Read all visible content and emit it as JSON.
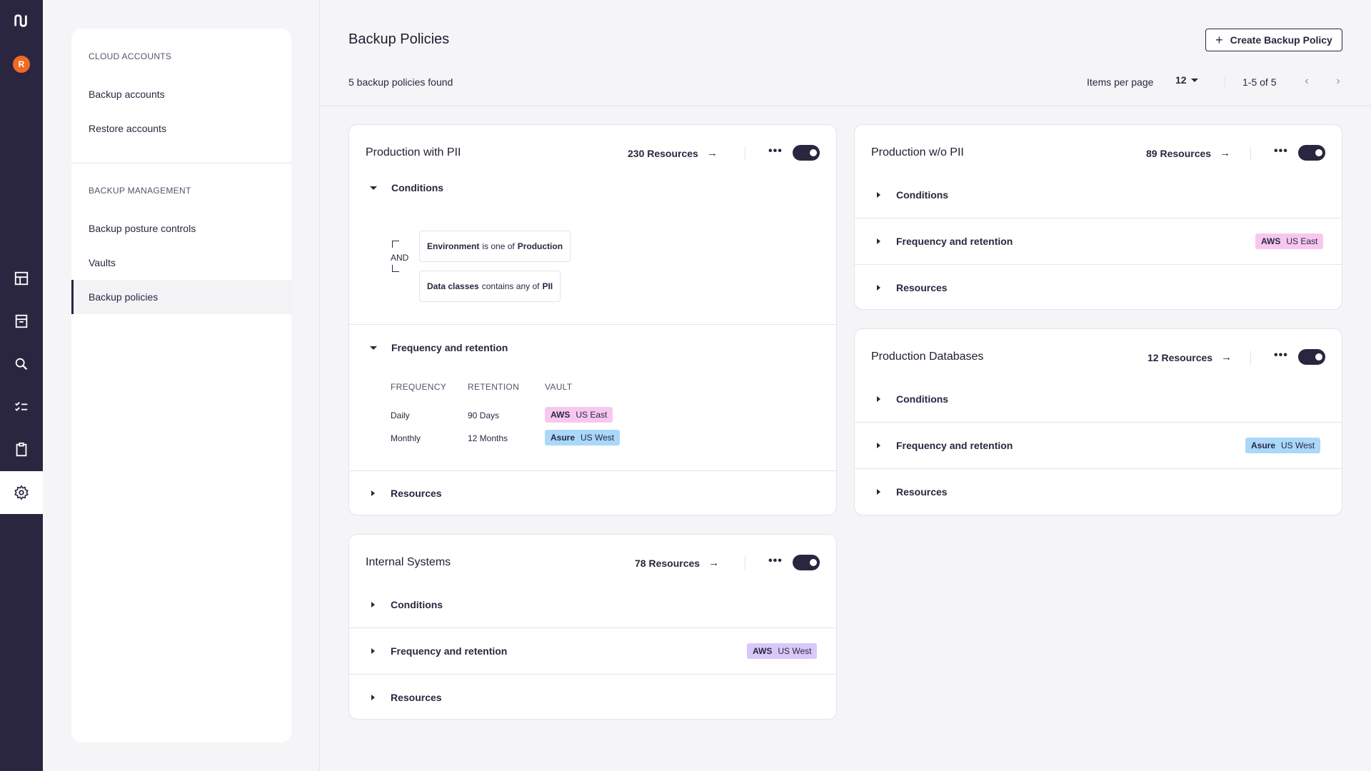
{
  "rail": {
    "user_initial": "R"
  },
  "nav": {
    "cloud_accounts": {
      "title": "CLOUD ACCOUNTS",
      "items": [
        "Backup accounts",
        "Restore accounts"
      ]
    },
    "backup_management": {
      "title": "BACKUP MANAGEMENT",
      "items": [
        "Backup posture controls",
        "Vaults",
        "Backup policies"
      ]
    },
    "active_item": "Backup policies"
  },
  "header": {
    "title": "Backup Policies",
    "create_button": "Create Backup Policy",
    "found_text": "5 backup policies found",
    "items_per_page_label": "Items per page",
    "items_per_page_value": "12",
    "range_text": "1-5 of 5"
  },
  "section_labels": {
    "conditions": "Conditions",
    "frequency": "Frequency and retention",
    "resources": "Resources"
  },
  "policies": [
    {
      "name": "Production with PII",
      "resources": "230 Resources",
      "enabled": true,
      "conditions": {
        "operator": "AND",
        "rules": [
          {
            "field": "Environment",
            "op": "is one of",
            "value": "Production"
          },
          {
            "field": "Data classes",
            "op": "contains any of",
            "value": "PII"
          }
        ]
      },
      "frequency_table": {
        "headers": [
          "FREQUENCY",
          "RETENTION",
          "VAULT"
        ],
        "rows": [
          {
            "frequency": "Daily",
            "retention": "90 Days",
            "vault_provider": "AWS",
            "vault_region": "US East"
          },
          {
            "frequency": "Monthly",
            "retention": "12 Months",
            "vault_provider": "Asure",
            "vault_region": "US West"
          }
        ]
      }
    },
    {
      "name": "Internal Systems",
      "resources": "78 Resources",
      "enabled": true,
      "vault_provider": "AWS",
      "vault_region": "US West"
    },
    {
      "name": "Production w/o PII",
      "resources": "89 Resources",
      "enabled": true,
      "vault_provider": "AWS",
      "vault_region": "US East"
    },
    {
      "name": "Production Databases",
      "resources": "12 Resources",
      "enabled": true,
      "vault_provider": "Asure",
      "vault_region": "US West"
    }
  ],
  "colors": {
    "rail": "#2a2640",
    "user_avatar": "#f06a26",
    "tag_aws_east": "#f7c8ef",
    "tag_asure": "#a9d8f9",
    "tag_aws_west": "#d9c8f7"
  }
}
